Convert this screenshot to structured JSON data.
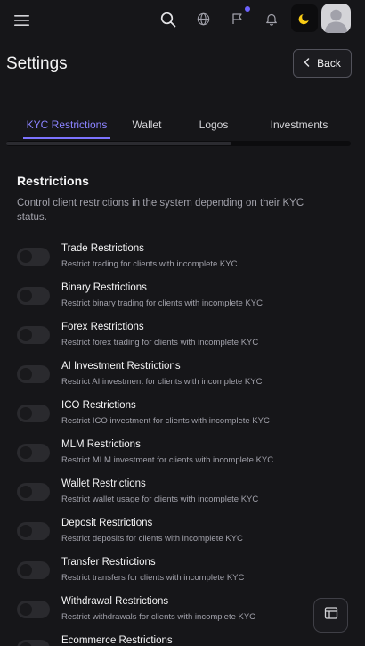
{
  "header": {
    "menu_icon": "hamburger-icon",
    "search_icon": "search-icon",
    "language_icon": "globe-icon",
    "announcement_icon": "flag-icon",
    "notifications_icon": "bell-icon",
    "theme_icon": "moon-icon",
    "avatar_icon": "user-avatar-icon",
    "accent_color": "#6d63ff"
  },
  "page": {
    "title": "Settings",
    "back_label": "Back"
  },
  "tabs": [
    {
      "label": "KYC Restrictions",
      "active": true
    },
    {
      "label": "Wallet",
      "active": false
    },
    {
      "label": "Logos",
      "active": false
    },
    {
      "label": "Investments",
      "active": false
    }
  ],
  "section": {
    "title": "Restrictions",
    "description": "Control client restrictions in the system depending on their KYC status."
  },
  "restrictions": [
    {
      "title": "Trade Restrictions",
      "desc": "Restrict trading for clients with incomplete KYC",
      "enabled": false
    },
    {
      "title": "Binary Restrictions",
      "desc": "Restrict binary trading for clients with incomplete KYC",
      "enabled": false
    },
    {
      "title": "Forex Restrictions",
      "desc": "Restrict forex trading for clients with incomplete KYC",
      "enabled": false
    },
    {
      "title": "AI Investment Restrictions",
      "desc": "Restrict AI investment for clients with incomplete KYC",
      "enabled": false
    },
    {
      "title": "ICO Restrictions",
      "desc": "Restrict ICO investment for clients with incomplete KYC",
      "enabled": false
    },
    {
      "title": "MLM Restrictions",
      "desc": "Restrict MLM investment for clients with incomplete KYC",
      "enabled": false
    },
    {
      "title": "Wallet Restrictions",
      "desc": "Restrict wallet usage for clients with incomplete KYC",
      "enabled": false
    },
    {
      "title": "Deposit Restrictions",
      "desc": "Restrict deposits for clients with incomplete KYC",
      "enabled": false
    },
    {
      "title": "Transfer Restrictions",
      "desc": "Restrict transfers for clients with incomplete KYC",
      "enabled": false
    },
    {
      "title": "Withdrawal Restrictions",
      "desc": "Restrict withdrawals for clients with incomplete KYC",
      "enabled": false
    },
    {
      "title": "Ecommerce Restrictions",
      "desc": "",
      "enabled": false
    }
  ],
  "floating": {
    "layout_icon": "layout-icon"
  }
}
